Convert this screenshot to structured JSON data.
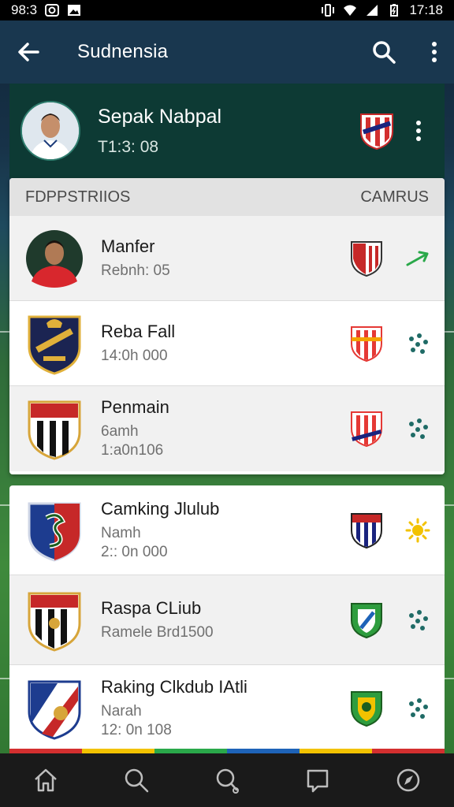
{
  "status_bar": {
    "left_text": "98:3",
    "right_text": "17:18"
  },
  "app_bar": {
    "title": "Sudnensia",
    "icons": [
      "back-arrow-icon",
      "search-icon",
      "more-vertical-icon"
    ]
  },
  "featured": {
    "name": "Sepak Nabpal",
    "time": "T1:3: 08",
    "icons": [
      "player-avatar",
      "club-crest-icon",
      "more-vertical-icon"
    ]
  },
  "list_header": {
    "left": "FDPPSTRIIOS",
    "right": "CAMRUS"
  },
  "rows": [
    {
      "name": "Manfer",
      "sub1": "Rebnh: 05",
      "sub2": "",
      "action_icon": "trend-up-arrow-icon"
    },
    {
      "name": "Reba Fall",
      "sub1": "14:0h 000",
      "sub2": "",
      "action_icon": "dots-cluster-icon"
    },
    {
      "name": "Penmain",
      "sub1": "6amh",
      "sub2": "1:a0n106",
      "action_icon": "dots-cluster-icon"
    }
  ],
  "rows2": [
    {
      "name": "Camking Jlulub",
      "sub1": "Namh",
      "sub2": "2:: 0n 000",
      "action_icon": "sun-icon"
    },
    {
      "name": "Raspa CLiub",
      "sub1": "Ramele Brd1500",
      "sub2": "",
      "action_icon": "dots-cluster-icon"
    },
    {
      "name": "Raking Clkdub IAtli",
      "sub1": "Narah",
      "sub2": "12: 0n 108",
      "action_icon": "dots-cluster-icon"
    }
  ],
  "bottom_nav": [
    "home-icon",
    "search-icon",
    "explore-icon",
    "chat-icon",
    "compass-icon"
  ],
  "colors": {
    "app_bar": "#19374f",
    "featured": "#0d3a34",
    "accent_green": "#2aa84a",
    "accent_yellow": "#f2c200",
    "teal": "#1f6b66"
  }
}
